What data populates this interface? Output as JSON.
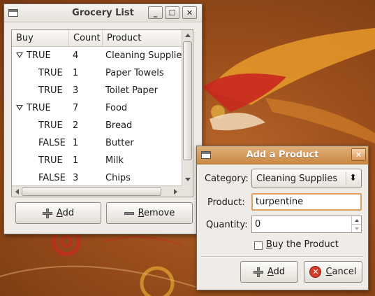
{
  "main_window": {
    "title": "Grocery List",
    "buttons": {
      "minimize": "_",
      "maximize": "☐",
      "close": "✕"
    }
  },
  "tree": {
    "columns": [
      "Buy",
      "Count",
      "Product"
    ],
    "rows": [
      {
        "buy": "TRUE",
        "count": "4",
        "product": "Cleaning Supplies",
        "level": 0,
        "expanded": true
      },
      {
        "buy": "TRUE",
        "count": "1",
        "product": "Paper Towels",
        "level": 1
      },
      {
        "buy": "TRUE",
        "count": "3",
        "product": "Toilet Paper",
        "level": 1
      },
      {
        "buy": "TRUE",
        "count": "7",
        "product": "Food",
        "level": 0,
        "expanded": true
      },
      {
        "buy": "TRUE",
        "count": "2",
        "product": "Bread",
        "level": 1
      },
      {
        "buy": "FALSE",
        "count": "1",
        "product": "Butter",
        "level": 1
      },
      {
        "buy": "TRUE",
        "count": "1",
        "product": "Milk",
        "level": 1
      },
      {
        "buy": "FALSE",
        "count": "3",
        "product": "Chips",
        "level": 1
      }
    ]
  },
  "actions": {
    "add_mnemonic": "A",
    "add_rest": "dd",
    "remove_mnemonic": "R",
    "remove_rest": "emove"
  },
  "dialog": {
    "title": "Add a Product",
    "close": "✕",
    "category_label": "Category:",
    "category_value": "Cleaning Supplies",
    "product_label": "Product:",
    "product_value": "turpentine",
    "quantity_label": "Quantity:",
    "quantity_value": "0",
    "buy_mnemonic": "B",
    "buy_rest": "uy the Product",
    "buy_checked": false,
    "add_mnemonic": "A",
    "add_rest": "dd",
    "cancel_mnemonic": "C",
    "cancel_rest": "ancel",
    "combo_arrows": "⬍"
  }
}
